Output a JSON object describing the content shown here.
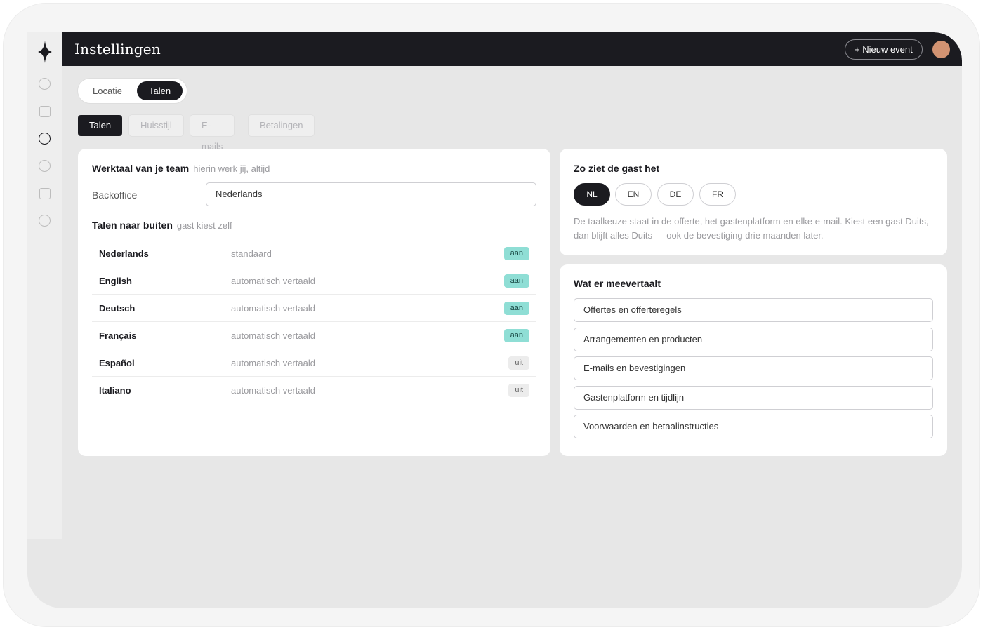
{
  "header": {
    "title": "Instellingen",
    "new_event_label": "+ Nieuw event"
  },
  "sidebar": {
    "icons": [
      "logo-star-icon",
      "circle-icon",
      "square-icon",
      "circle-icon-active",
      "circle-icon",
      "square-icon",
      "circle-icon"
    ]
  },
  "segment": {
    "items": [
      {
        "label": "Locatie",
        "active": false
      },
      {
        "label": "Talen",
        "active": true
      }
    ]
  },
  "tabs": [
    {
      "label": "Talen",
      "active": true
    },
    {
      "label": "Huisstijl",
      "active": false
    },
    {
      "label": "E-mails",
      "active": false
    },
    {
      "label": "Betalingen",
      "active": false
    }
  ],
  "werktaal": {
    "title": "Werktaal van je team",
    "subtitle": "hierin werk jij, altijd",
    "backoffice_label": "Backoffice",
    "backoffice_value": "Nederlands"
  },
  "talen_buiten": {
    "title": "Talen naar buiten",
    "subtitle": "gast kiest zelf",
    "rows": [
      {
        "name": "Nederlands",
        "mode": "standaard",
        "status": "aan"
      },
      {
        "name": "English",
        "mode": "automatisch vertaald",
        "status": "aan"
      },
      {
        "name": "Deutsch",
        "mode": "automatisch vertaald",
        "status": "aan"
      },
      {
        "name": "Français",
        "mode": "automatisch vertaald",
        "status": "aan"
      },
      {
        "name": "Español",
        "mode": "automatisch vertaald",
        "status": "uit"
      },
      {
        "name": "Italiano",
        "mode": "automatisch vertaald",
        "status": "uit"
      }
    ]
  },
  "gast": {
    "title": "Zo ziet de gast het",
    "languages": [
      {
        "code": "NL",
        "active": true
      },
      {
        "code": "EN",
        "active": false
      },
      {
        "code": "DE",
        "active": false
      },
      {
        "code": "FR",
        "active": false
      }
    ],
    "description": "De taalkeuze staat in de offerte, het gastenplatform en elke e-mail. Kiest een gast Duits, dan blijft alles Duits — ook de bevestiging drie maanden later."
  },
  "meevertaalt": {
    "title": "Wat er meevertaalt",
    "items": [
      "Offertes en offerteregels",
      "Arrangementen en producten",
      "E-mails en bevestigingen",
      "Gastenplatform en tijdlijn",
      "Voorwaarden en betaalinstructies"
    ]
  },
  "colors": {
    "dark": "#1b1b20",
    "accent_on": "#8fded5",
    "avatar": "#d29372"
  }
}
